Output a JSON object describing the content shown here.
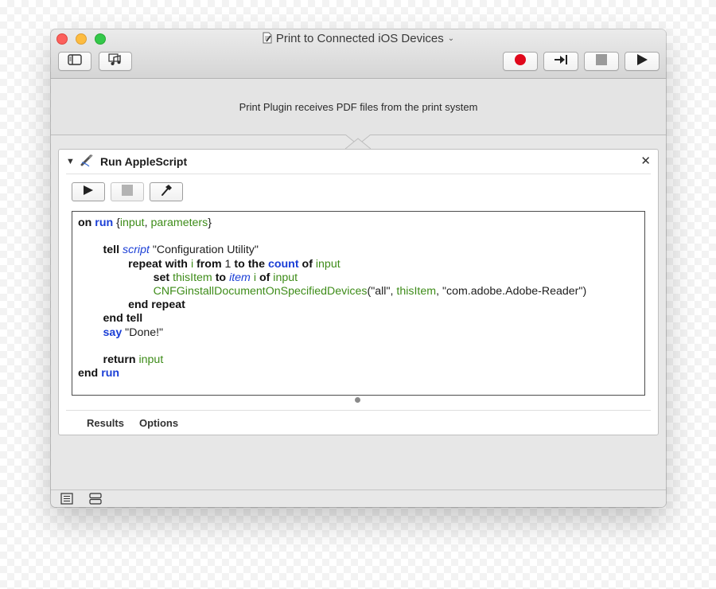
{
  "window": {
    "title": "Print to Connected iOS Devices"
  },
  "toolbar": {
    "left_buttons": [
      "library-icon",
      "media-icon"
    ],
    "right_buttons": [
      "record-icon",
      "step-icon",
      "stop-icon",
      "run-icon"
    ]
  },
  "workflow": {
    "input_description": "Print Plugin receives PDF files from the print system"
  },
  "action": {
    "title": "Run AppleScript",
    "buttons": [
      "run-icon",
      "stop-icon",
      "compile-icon"
    ],
    "code": {
      "l1_a": "on",
      "l1_b": "run",
      "l1_c": " {",
      "l1_d": "input",
      "l1_e": ", ",
      "l1_f": "parameters",
      "l1_g": "}",
      "l3_a": "tell",
      "l3_b": "script",
      "l3_c": " \"Configuration Utility\"",
      "l4_a": "repeat with",
      "l4_b": "i",
      "l4_c": "from",
      "l4_d": "1",
      "l4_e": "to the",
      "l4_f": "count",
      "l4_g": "of",
      "l4_h": "input",
      "l5_a": "set",
      "l5_b": "thisItem",
      "l5_c": "to",
      "l5_d": "item",
      "l5_e": "i",
      "l5_f": "of",
      "l5_g": "input",
      "l6_a": "CNFGinstallDocumentOnSpecifiedDevices",
      "l6_b": "(\"all\", ",
      "l6_c": "thisItem",
      "l6_d": ", \"com.adobe.Adobe-Reader\")",
      "l7": "end repeat",
      "l8": "end tell",
      "l9_a": "say",
      "l9_b": " \"Done!\"",
      "l11_a": "return",
      "l11_b": "input",
      "l12_a": "end",
      "l12_b": "run"
    },
    "tabs": [
      "Results",
      "Options"
    ]
  },
  "colors": {
    "keyword_blue": "#1a3ed6",
    "variable_green": "#3e8c19",
    "record_red": "#e0081c"
  }
}
